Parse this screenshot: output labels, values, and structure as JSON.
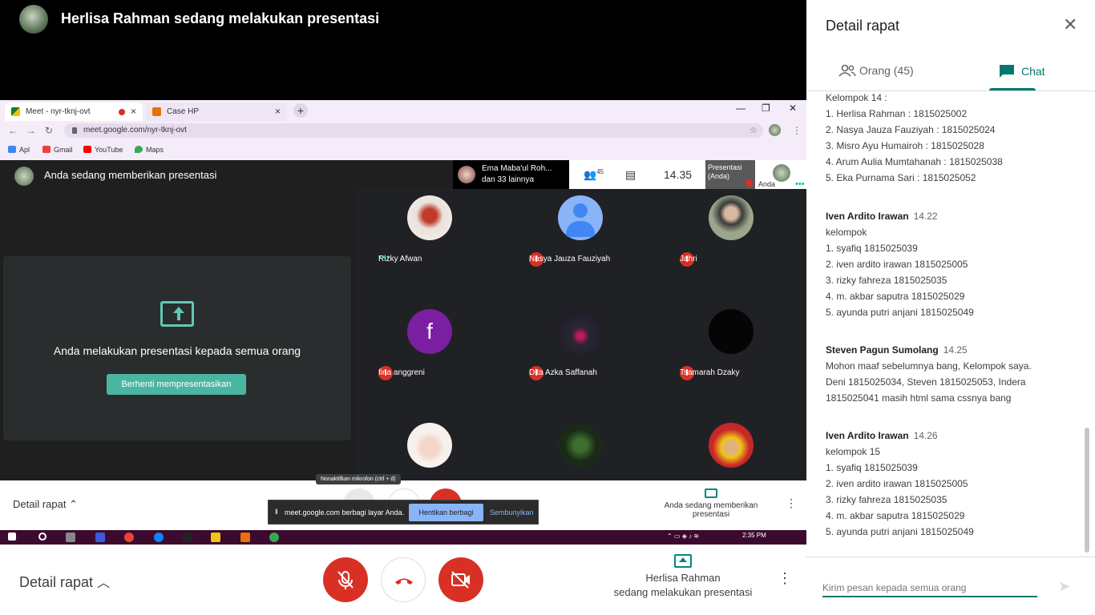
{
  "header": {
    "presenter_title": "Herlisa Rahman sedang melakukan presentasi"
  },
  "browser": {
    "tabs": [
      {
        "label": "Meet - nyr-tknj-ovt",
        "close": "×"
      },
      {
        "label": "Case HP",
        "close": "×"
      }
    ],
    "new_tab": "+",
    "window_controls": [
      "—",
      "❐",
      "✕"
    ],
    "url": "meet.google.com/nyr-tknj-ovt",
    "bookmarks": [
      "Apl",
      "Gmail",
      "YouTube",
      "Maps"
    ]
  },
  "inner_meet": {
    "title": "Anda sedang memberikan presentasi",
    "speaker_line1": "Ema Maba'ul Roh...",
    "speaker_line2": "dan 33 lainnya",
    "people_count": "45",
    "clock": "14.35",
    "self_tile": "Presentasi (Anda)",
    "you_label": "Anda",
    "presenting_text": "Anda melakukan presentasi kepada semua orang",
    "stop_button": "Berhenti mempresentasikan",
    "participants": [
      {
        "name": "Rizky Afwan",
        "muted": false,
        "color": "#e9e4e0"
      },
      {
        "name": "Nasya Jauza Fauziyah",
        "muted": true,
        "color": "#4285f4"
      },
      {
        "name": "Jahri",
        "muted": true,
        "color": "#8a9a7a"
      },
      {
        "name": "fina anggreni",
        "muted": true,
        "color": "#7b1fa2",
        "initial": "f"
      },
      {
        "name": "Dita Azka Saffanah",
        "muted": true,
        "color": "#2a2633"
      },
      {
        "name": "Tsamarah Dzaky",
        "muted": true,
        "color": "#050505"
      }
    ],
    "detail_label": "Detail rapat",
    "present_caption": "Anda sedang memberikan presentasi",
    "tooltip": "Nonaktifkan mikrofon (ctrl + d)",
    "share_text": "meet.google.com berbagi layar Anda.",
    "stop_share": "Hentikan berbagi",
    "hide": "Sembunyikan",
    "taskbar_time": "2:35 PM"
  },
  "bottom": {
    "detail_label": "Detail rapat",
    "present_line1": "Herlisa Rahman",
    "present_line2": "sedang melakukan presentasi"
  },
  "panel": {
    "title": "Detail rapat",
    "tab_people": "Orang (45)",
    "tab_chat": "Chat",
    "input_placeholder": "Kirim pesan kepada semua orang"
  },
  "chat": {
    "m0": {
      "lines": [
        "Kelompok 14 :",
        "1. Herlisa Rahman : 1815025002",
        "2. Nasya Jauza Fauziyah : 1815025024",
        "3. Misro Ayu Humairoh : 1815025028",
        "4. Arum Aulia Mumtahanah : 1815025038",
        "5. Eka Purnama Sari : 1815025052"
      ]
    },
    "m1": {
      "sender": "Iven Ardito Irawan",
      "time": "14.22",
      "lines": [
        "kelompok",
        "1. syafiq 1815025039",
        "2. iven ardito irawan 1815025005",
        "3. rizky fahreza 1815025035",
        "4. m. akbar saputra 1815025029",
        "5. ayunda putri anjani 1815025049"
      ]
    },
    "m2": {
      "sender": "Steven Pagun Sumolang",
      "time": "14.25",
      "lines": [
        "Mohon maaf sebelumnya bang, Kelompok saya.",
        "Deni 1815025034, Steven 1815025053, Indera",
        "1815025041 masih html sama cssnya bang"
      ]
    },
    "m3": {
      "sender": "Iven Ardito Irawan",
      "time": "14.26",
      "lines": [
        "kelompok 15",
        "1. syafiq 1815025039",
        "2. iven ardito irawan 1815025005",
        "3. rizky fahreza 1815025035",
        "4. m. akbar saputra 1815025029",
        "5. ayunda putri anjani 1815025049"
      ]
    }
  },
  "colors": {
    "accent": "#00796b",
    "danger": "#d93025",
    "teal_button": "#4cb5a2"
  }
}
